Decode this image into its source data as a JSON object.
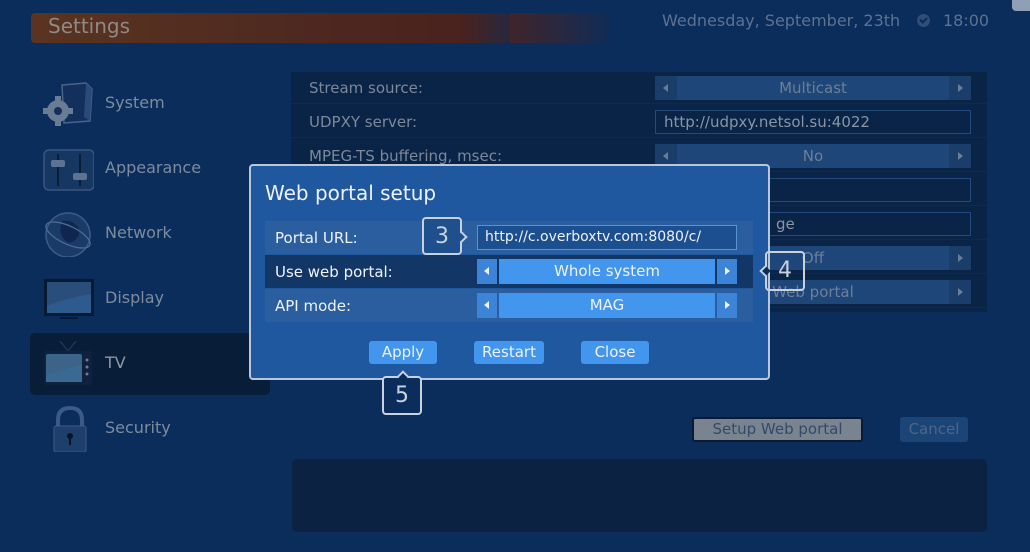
{
  "header": {
    "title": "Settings",
    "date": "Wednesday, September, 23th",
    "time": "18:00",
    "clock_icon": "clock-icon"
  },
  "sidebar": {
    "items": [
      {
        "label": "System",
        "icon": "gear-box-icon",
        "active": false
      },
      {
        "label": "Appearance",
        "icon": "sliders-icon",
        "active": false
      },
      {
        "label": "Network",
        "icon": "globe-icon",
        "active": false
      },
      {
        "label": "Display",
        "icon": "monitor-icon",
        "active": false
      },
      {
        "label": "TV",
        "icon": "tv-icon",
        "active": true
      },
      {
        "label": "Security",
        "icon": "padlock-icon",
        "active": false
      }
    ]
  },
  "settings": {
    "rows": [
      {
        "label": "Stream source:",
        "type": "selector",
        "value": "Multicast"
      },
      {
        "label": "UDPXY server:",
        "type": "text",
        "value": "http://udpxy.netsol.su:4022"
      },
      {
        "label": "MPEG-TS buffering, msec:",
        "type": "selector",
        "value": "No"
      },
      {
        "label": "",
        "type": "text",
        "value": ""
      },
      {
        "label": "",
        "type": "text",
        "value": "ge"
      },
      {
        "label": "",
        "type": "selector",
        "value": "Off"
      },
      {
        "label": "",
        "type": "selector",
        "value": "Web portal"
      }
    ],
    "setup_button": "Setup Web portal",
    "cancel_button": "Cancel"
  },
  "dialog": {
    "title": "Web portal setup",
    "rows": [
      {
        "label": "Portal URL:",
        "type": "text",
        "value": "http://c.overboxtv.com:8080/c/"
      },
      {
        "label": "Use web portal:",
        "type": "selector",
        "value": "Whole system",
        "focused": true
      },
      {
        "label": "API mode:",
        "type": "selector",
        "value": "MAG"
      }
    ],
    "buttons": {
      "apply": "Apply",
      "restart": "Restart",
      "close": "Close"
    }
  },
  "callouts": {
    "step3": "3",
    "step4": "4",
    "step5": "5"
  }
}
